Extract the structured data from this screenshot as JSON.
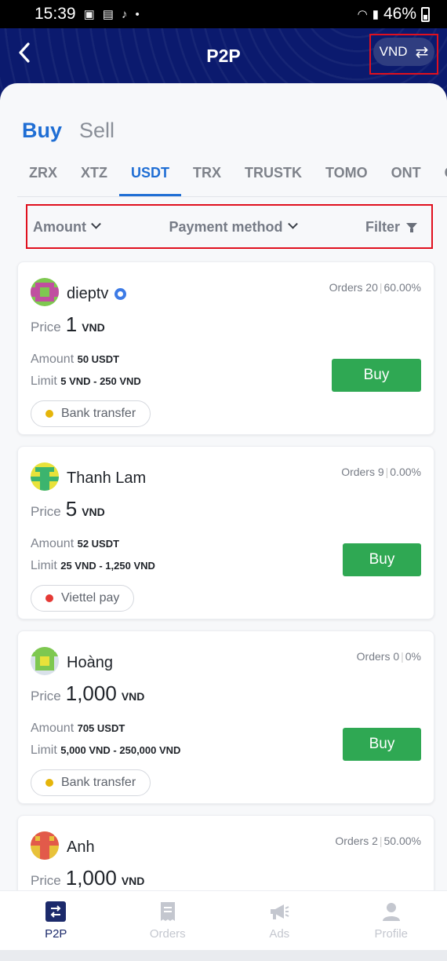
{
  "status": {
    "time": "15:39",
    "battery": "46%"
  },
  "header": {
    "title": "P2P",
    "currency": "VND"
  },
  "tabs": {
    "buy": "Buy",
    "sell": "Sell"
  },
  "coins": [
    "ZRX",
    "XTZ",
    "USDT",
    "TRX",
    "TRUSTK",
    "TOMO",
    "ONT",
    "O"
  ],
  "filters": {
    "amount": "Amount",
    "payment": "Payment method",
    "filter": "Filter"
  },
  "labels": {
    "price": "Price",
    "amount": "Amount",
    "limit": "Limit",
    "buy": "Buy"
  },
  "offers": [
    {
      "name": "dieptv",
      "verified": true,
      "orders": "Orders 20",
      "rate": "60.00%",
      "price": "1",
      "unit": "VND",
      "amount": "50 USDT",
      "limit": "5 VND - 250 VND",
      "payment": "Bank transfer",
      "payment_color": "#e5b50a"
    },
    {
      "name": "Thanh Lam",
      "verified": false,
      "orders": "Orders 9",
      "rate": "0.00%",
      "price": "5",
      "unit": "VND",
      "amount": "52 USDT",
      "limit": "25 VND - 1,250 VND",
      "payment": "Viettel pay",
      "payment_color": "#e53935"
    },
    {
      "name": "Hoàng",
      "verified": false,
      "orders": "Orders 0",
      "rate": "0%",
      "price": "1,000",
      "unit": "VND",
      "amount": "705 USDT",
      "limit": "5,000 VND - 250,000 VND",
      "payment": "Bank transfer",
      "payment_color": "#e5b50a"
    },
    {
      "name": "Anh",
      "verified": false,
      "orders": "Orders 2",
      "rate": "50.00%",
      "price": "1,000",
      "unit": "VND"
    }
  ],
  "nav": [
    {
      "label": "P2P",
      "icon": "p2p-icon",
      "active": true
    },
    {
      "label": "Orders",
      "icon": "receipt-icon",
      "active": false
    },
    {
      "label": "Ads",
      "icon": "megaphone-icon",
      "active": false
    },
    {
      "label": "Profile",
      "icon": "person-icon",
      "active": false
    }
  ]
}
